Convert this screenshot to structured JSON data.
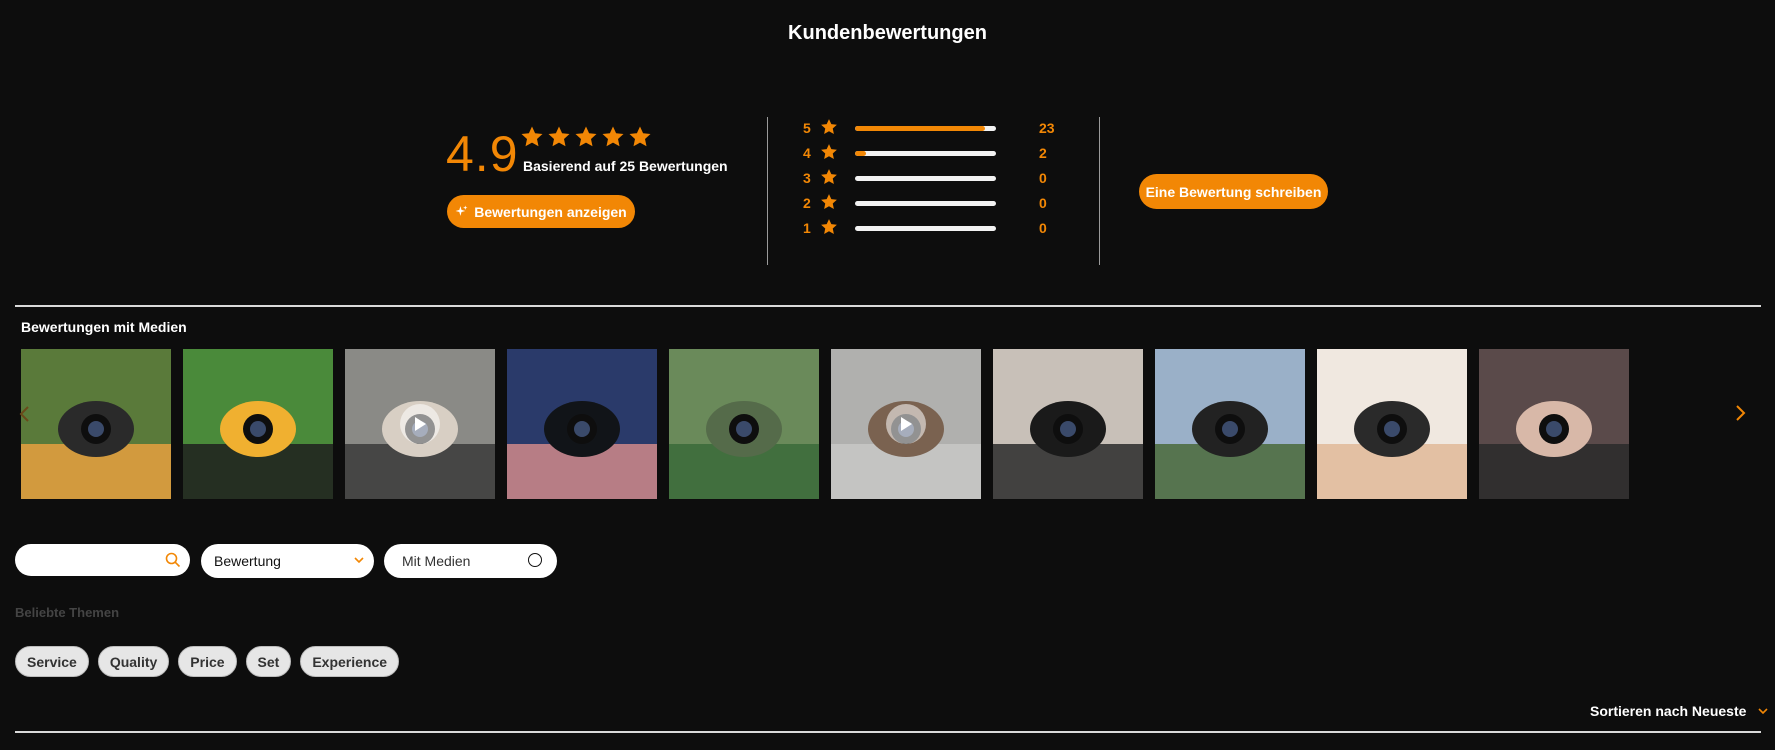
{
  "header": {
    "title": "Kundenbewertungen"
  },
  "summary": {
    "average": "4.9",
    "rating_value": 4.9,
    "rating_max": 5,
    "based_on": "Basierend auf 25 Bewertungen",
    "show_reviews_label": "Bewertungen anzeigen",
    "write_review_label": "Eine Bewertung schreiben",
    "accent_color": "#f28705"
  },
  "histogram": [
    {
      "stars": "5",
      "count": "23",
      "fraction": 0.92
    },
    {
      "stars": "4",
      "count": "2",
      "fraction": 0.08
    },
    {
      "stars": "3",
      "count": "0",
      "fraction": 0
    },
    {
      "stars": "2",
      "count": "0",
      "fraction": 0
    },
    {
      "stars": "1",
      "count": "0",
      "fraction": 0
    }
  ],
  "media": {
    "title": "Bewertungen mit Medien",
    "items": [
      {
        "kind": "photo",
        "icon": "woman-with-camera"
      },
      {
        "kind": "photo",
        "icon": "camera-screen-flower"
      },
      {
        "kind": "video",
        "icon": "hand-holding-camera"
      },
      {
        "kind": "photo",
        "icon": "camera-at-sunset-beach"
      },
      {
        "kind": "photo",
        "icon": "child-with-camera"
      },
      {
        "kind": "video",
        "icon": "person-head"
      },
      {
        "kind": "photo",
        "icon": "man-holding-dslr"
      },
      {
        "kind": "photo",
        "icon": "camera-on-tripod-mountains"
      },
      {
        "kind": "photo",
        "icon": "hands-holding-lens"
      },
      {
        "kind": "photo",
        "icon": "woman-holding-camera"
      }
    ]
  },
  "filters": {
    "search_placeholder": "",
    "rating_select": "Bewertung",
    "media_toggle": "Mit Medien"
  },
  "topics": {
    "label": "Beliebte Themen",
    "items": [
      "Service",
      "Quality",
      "Price",
      "Set",
      "Experience"
    ]
  },
  "sort": {
    "label": "Sortieren nach Neueste"
  }
}
